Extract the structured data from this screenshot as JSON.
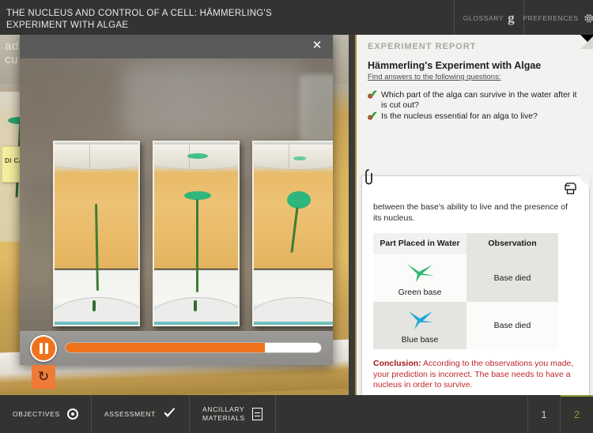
{
  "topbar": {
    "title_line1": "THE NUCLEUS AND CONTROL OF A CELL: HÄMMERLING'S",
    "title_line2": "EXPERIMENT WITH ALGAE",
    "glossary_label": "GLOSSARY",
    "glossary_icon": "book-g-icon",
    "preferences_label": "PREFERENCES",
    "preferences_icon": "gear-icon"
  },
  "scene": {
    "bg_text_line1": "ad",
    "bg_text_line2": "cu",
    "sticky_line1": "DI",
    "sticky_line2": "CAR"
  },
  "modal": {
    "close_label": "✕",
    "close_icon": "close-icon",
    "play_state": "pause",
    "play_icon": "pause-icon",
    "progress_percent": 78,
    "replay_icon": "replay-icon",
    "frames": [
      {
        "caption": "stage-1-no-cap"
      },
      {
        "caption": "stage-2-small-cap"
      },
      {
        "caption": "stage-3-full-cap"
      }
    ]
  },
  "report": {
    "section_label": "EXPERIMENT REPORT",
    "title": "Hämmerling's Experiment with Algae",
    "subtitle": "Find answers to the following questions:",
    "questions": [
      "Which part of the alga can survive in the water after it is cut out?",
      "Is the nucleus essential for an alga to live?"
    ],
    "card": {
      "clip_icon": "paperclip-icon",
      "print_icon": "printer-icon",
      "intro_text": "between the base's ability to live and the presence of its nucleus.",
      "table": {
        "headers": [
          "Part Placed in Water",
          "Observation"
        ],
        "rows": [
          {
            "specimen_label": "Green base",
            "specimen_color": "#2eb86e",
            "observation": "Base died"
          },
          {
            "specimen_label": "Blue base",
            "specimen_color": "#21a8d8",
            "observation": "Base died"
          }
        ]
      },
      "conclusion_label": "Conclusion:",
      "conclusion_text": "According to the observations you made, your prediction is incorrect. The base needs to have a nucleus in order to survive."
    }
  },
  "bottombar": {
    "items": [
      {
        "label": "OBJECTIVES",
        "icon": "target-icon"
      },
      {
        "label_line1": "ASSESSMENT",
        "icon": "checkmark-icon"
      },
      {
        "label_line1": "ANCILLARY",
        "label_line2": "MATERIALS",
        "icon": "document-icon"
      }
    ],
    "objectives_label": "OBJECTIVES",
    "assessment_label": "ASSESSMENT",
    "ancillary_label_line1": "ANCILLARY",
    "ancillary_label_line2": "MATERIALS",
    "page_prev": "1",
    "page_current": "2"
  },
  "colors": {
    "accent_orange": "#f0721d",
    "accent_green": "#8f9a33",
    "conclusion_red": "#c0262b",
    "panel_border_gold": "#b08b3a"
  }
}
